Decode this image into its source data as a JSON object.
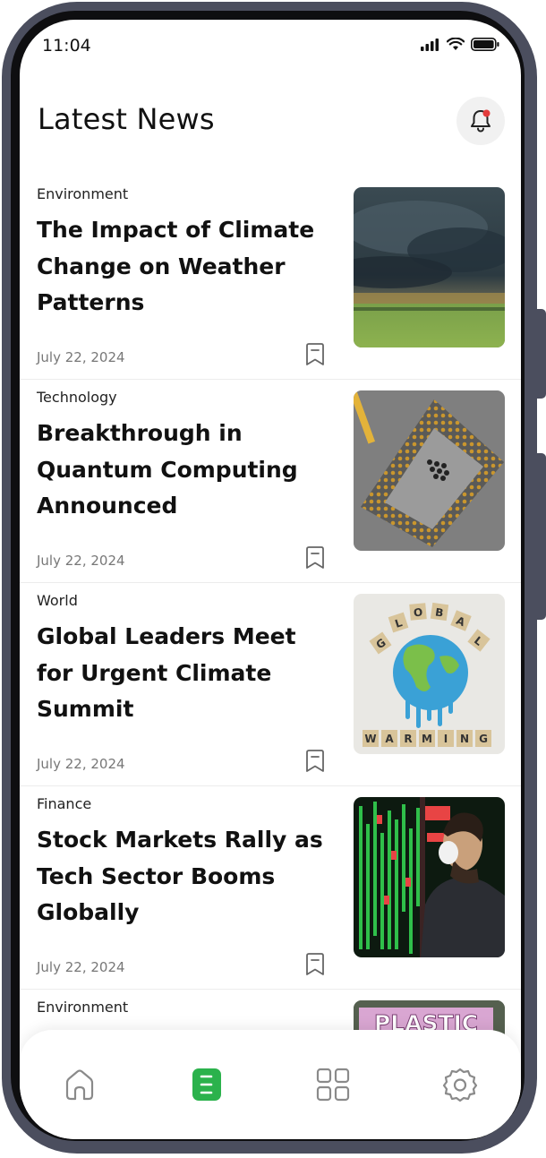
{
  "status_bar": {
    "time": "11:04"
  },
  "header": {
    "title": "Latest News"
  },
  "articles": [
    {
      "category": "Environment",
      "title": "The Impact of Climate Change on Weather Patterns",
      "date": "July 22, 2024",
      "image": "storm-landscape"
    },
    {
      "category": "Technology",
      "title": "Breakthrough in Quantum Computing Announced",
      "date": "July 22, 2024",
      "image": "cpu-chip"
    },
    {
      "category": "World",
      "title": "Global Leaders Meet for Urgent Climate Summit",
      "date": "July 22, 2024",
      "image": "global-warming-globe"
    },
    {
      "category": "Finance",
      "title": "Stock Markets Rally as Tech Sector Booms Globally",
      "date": "July 22, 2024",
      "image": "stock-board-man"
    },
    {
      "category": "Environment",
      "title": "",
      "date": "",
      "image": "plastic-sign",
      "image_text": "PLASTIC"
    }
  ],
  "globe_letters_top": [
    "G",
    "L",
    "O",
    "B",
    "A",
    "L"
  ],
  "globe_letters_bottom": [
    "W",
    "A",
    "R",
    "M",
    "I",
    "N",
    "G"
  ],
  "tab_bar": {
    "items": [
      {
        "icon": "home-icon",
        "active": false
      },
      {
        "icon": "news-icon",
        "active": true
      },
      {
        "icon": "grid-icon",
        "active": false
      },
      {
        "icon": "gear-icon",
        "active": false
      }
    ],
    "accent": "#2bb24c"
  }
}
